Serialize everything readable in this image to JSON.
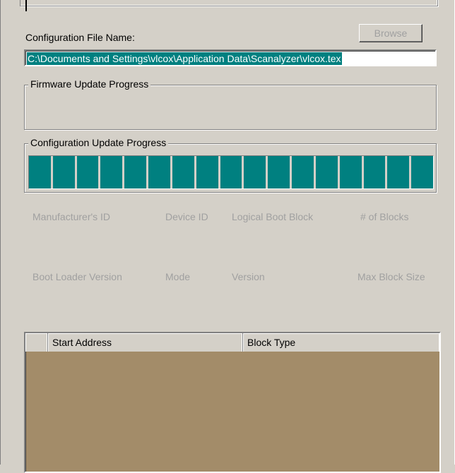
{
  "config": {
    "file_label": "Configuration File Name:",
    "browse_label": "Browse",
    "file_value": "C:\\Documents and Settings\\vlcox\\Application Data\\Scanalyzer\\vlcox.tex"
  },
  "firmware_group": {
    "title": "Firmware Update Progress"
  },
  "config_group": {
    "title": "Configuration Update Progress",
    "progress": 1.0
  },
  "fields": {
    "manufacturer_id": "Manufacturer's ID",
    "device_id": "Device ID",
    "logical_boot_block": "Logical Boot Block",
    "num_blocks": "# of Blocks",
    "boot_loader_version": "Boot Loader Version",
    "mode": "Mode",
    "version": "Version",
    "max_block_size": "Max Block Size"
  },
  "block_list": {
    "columns": [
      "",
      "Start Address",
      "Block Type"
    ],
    "rows": []
  },
  "colors": {
    "accent": "#008080",
    "list_bg": "#a38c69",
    "face": "#d4d0c8"
  }
}
